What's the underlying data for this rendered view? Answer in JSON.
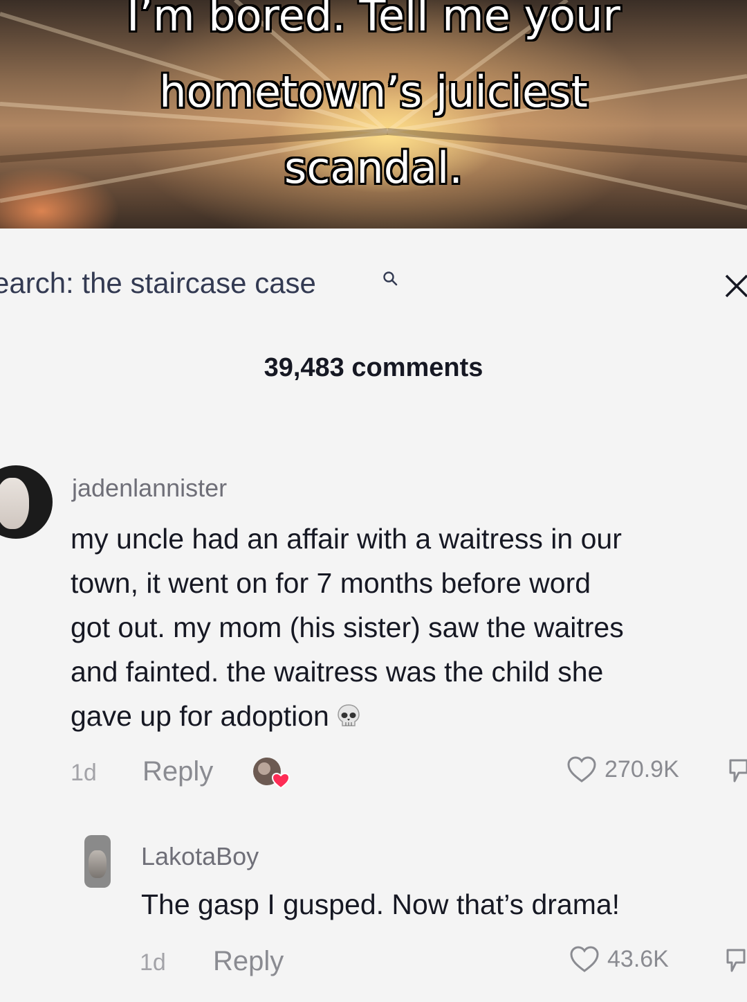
{
  "video": {
    "caption_lines": [
      "I’m bored. Tell me your",
      "hometown’s juiciest",
      "scandal."
    ]
  },
  "search": {
    "prefix": "earch: ",
    "query": "the staircase case",
    "icon": "search-icon",
    "close_icon": "close-icon"
  },
  "comments_header": {
    "count_label": "39,483 comments"
  },
  "comments": [
    {
      "username": "jadenlannister",
      "text_lines": [
        "my uncle had an affair with a waitress in our",
        "town, it went on for 7 months before word",
        "got out. my mom (his sister) saw the waitres",
        "and fainted. the waitress was the child she",
        "gave up for adoption"
      ],
      "emoji": "skull-emoji",
      "time": "1d",
      "reply_label": "Reply",
      "creator_liked": true,
      "likes": "270.9K"
    },
    {
      "username": "LakotaBoy",
      "text_lines": [
        "The gasp I gusped. Now that’s drama!"
      ],
      "time": "1d",
      "reply_label": "Reply",
      "likes": "43.6K"
    }
  ],
  "colors": {
    "text_primary": "#161823",
    "text_secondary": "#8a8b91",
    "search_link": "#333a52",
    "creator_heart": "#fe2c55"
  }
}
